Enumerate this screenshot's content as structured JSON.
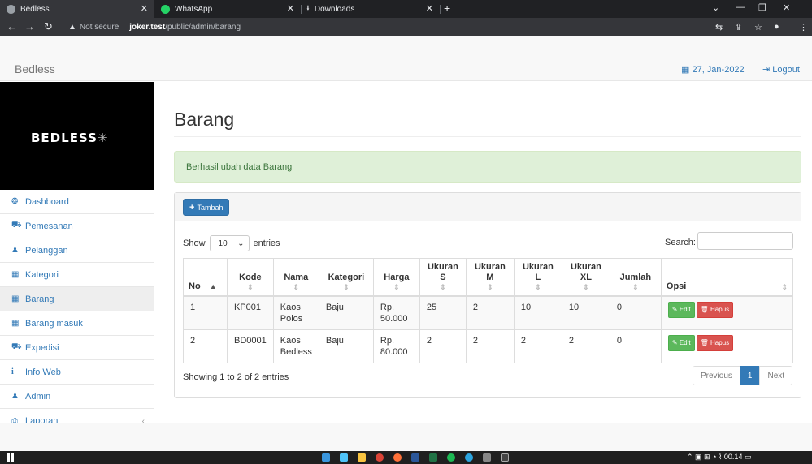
{
  "browser": {
    "tabs": [
      {
        "title": "Bedless",
        "active": true,
        "icon": "globe-icon",
        "icon_color": "#9aa0a6"
      },
      {
        "title": "WhatsApp",
        "active": false,
        "icon": "whatsapp-icon",
        "icon_color": "#25d366"
      },
      {
        "title": "Downloads",
        "active": false,
        "icon": "download-icon",
        "icon_color": "#e8eaed"
      }
    ],
    "new_tab": "+",
    "address": {
      "security": "Not secure",
      "host": "joker.test",
      "path": "/public/admin/barang"
    }
  },
  "navbar": {
    "brand": "Bedless",
    "date": "27, Jan-2022",
    "logout": "Logout"
  },
  "sidebar": {
    "logo": "BEDLESS",
    "items": [
      {
        "label": "Dashboard",
        "icon": "dashboard-icon",
        "glyph": "❂"
      },
      {
        "label": "Pemesanan",
        "icon": "cart-icon",
        "glyph": "⛟"
      },
      {
        "label": "Pelanggan",
        "icon": "users-icon",
        "glyph": "👥"
      },
      {
        "label": "Kategori",
        "icon": "table-icon",
        "glyph": "▦"
      },
      {
        "label": "Barang",
        "icon": "table-icon",
        "glyph": "▦",
        "active": true
      },
      {
        "label": "Barang masuk",
        "icon": "table-icon",
        "glyph": "▦"
      },
      {
        "label": "Expedisi",
        "icon": "truck-icon",
        "glyph": "⛟"
      },
      {
        "label": "Info Web",
        "icon": "info-icon",
        "glyph": "i"
      },
      {
        "label": "Admin",
        "icon": "user-icon",
        "glyph": "♟"
      },
      {
        "label": "Laporan",
        "icon": "print-icon",
        "glyph": "⎙"
      }
    ]
  },
  "page": {
    "title": "Barang",
    "alert": "Berhasil ubah data Barang",
    "add_button": "Tambah",
    "show_label": "Show",
    "entries_value": "10",
    "entries_label": "entries",
    "search_label": "Search:",
    "search_value": "",
    "info": "Showing 1 to 2 of 2 entries",
    "pager": {
      "previous": "Previous",
      "current": "1",
      "next": "Next"
    }
  },
  "table": {
    "columns": [
      "No",
      "Kode",
      "Nama",
      "Kategori",
      "Harga",
      "Ukuran S",
      "Ukuran M",
      "Ukuran L",
      "Ukuran XL",
      "Jumlah",
      "Opsi"
    ],
    "rows": [
      {
        "no": "1",
        "kode": "KP001",
        "nama": "Kaos Polos",
        "kategori": "Baju",
        "harga": "Rp. 50.000",
        "s": "25",
        "m": "2",
        "l": "10",
        "xl": "10",
        "jumlah": "0"
      },
      {
        "no": "2",
        "kode": "BD0001",
        "nama": "Kaos Bedless",
        "kategori": "Baju",
        "harga": "Rp. 80.000",
        "s": "2",
        "m": "2",
        "l": "2",
        "xl": "2",
        "jumlah": "0"
      }
    ],
    "edit_label": "Edit",
    "delete_label": "Hapus"
  },
  "colors": {
    "primary": "#337ab7",
    "success": "#5cb85c",
    "danger": "#d9534f",
    "alert_bg": "#dff0d8"
  },
  "taskbar": {
    "time": "00.14"
  }
}
